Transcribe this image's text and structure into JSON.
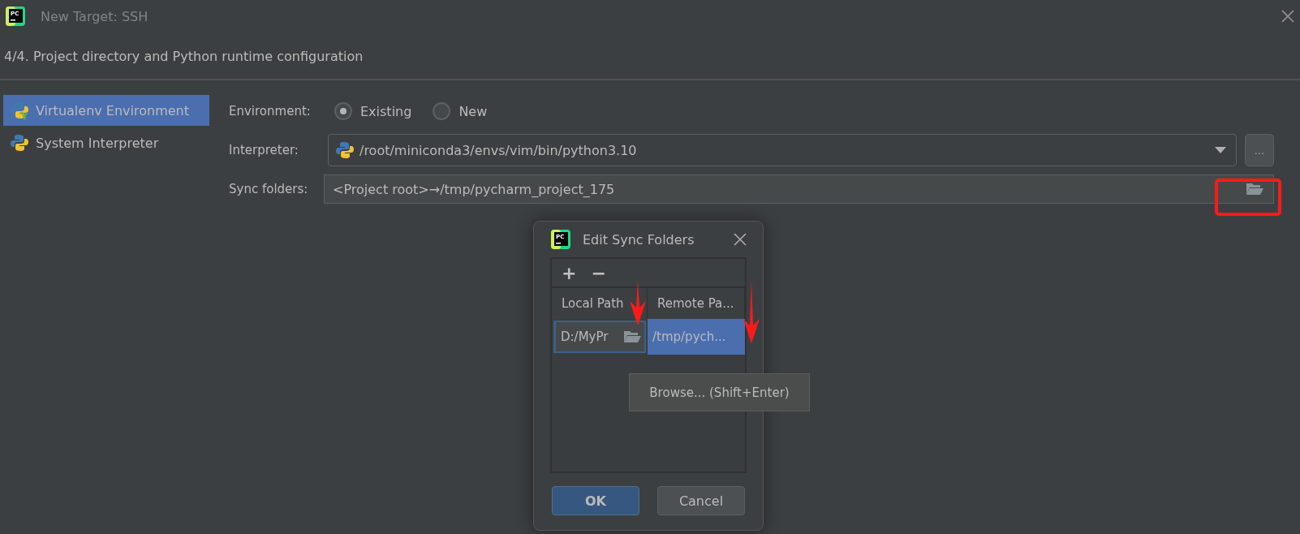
{
  "window": {
    "logo": "PC",
    "title": "New Target: SSH"
  },
  "step": "4/4. Project directory and Python runtime configuration",
  "sidebar": {
    "items": [
      {
        "label": "Virtualenv Environment",
        "kind": "virtualenv",
        "selected": true
      },
      {
        "label": "System Interpreter",
        "kind": "system",
        "selected": false
      }
    ]
  },
  "form": {
    "environment": {
      "label": "Environment:",
      "options": [
        {
          "label": "Existing",
          "selected": true
        },
        {
          "label": "New",
          "selected": false
        }
      ]
    },
    "interpreter": {
      "label": "Interpreter:",
      "value": "/root/miniconda3/envs/vim/bin/python3.10",
      "more_button": "..."
    },
    "sync_folders": {
      "label": "Sync folders:",
      "value": "<Project root>→/tmp/pycharm_project_175"
    }
  },
  "popup": {
    "logo": "PC",
    "title": "Edit Sync Folders",
    "toolbar": [
      "+",
      "−"
    ],
    "columns": [
      "Local Path",
      "Remote Pa..."
    ],
    "rows": [
      {
        "selected": true,
        "cells": [
          {
            "text": "D:/MyPr",
            "editing": true
          },
          {
            "text": "/tmp/pych...",
            "editing": false
          }
        ]
      }
    ],
    "tooltip": "Browse... (Shift+Enter)",
    "buttons": [
      {
        "label": "OK",
        "kind": "default"
      },
      {
        "label": "Cancel",
        "kind": "normal"
      }
    ]
  }
}
